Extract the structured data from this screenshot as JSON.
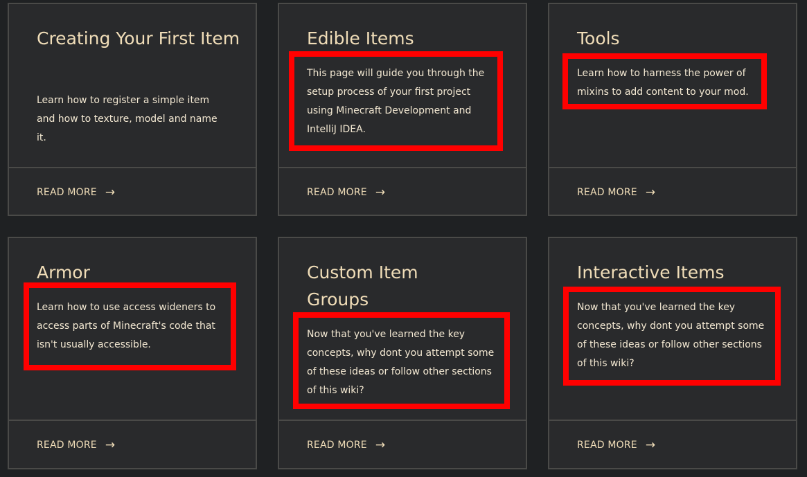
{
  "cards": [
    {
      "title": "Creating Your First Item",
      "description": "Learn how to register a simple item and how to texture, model and name it.",
      "read_more": "READ MORE",
      "highlighted": false
    },
    {
      "title": "Edible Items",
      "description": "This page will guide you through the setup process of your first project using Minecraft Development and IntelliJ IDEA.",
      "read_more": "READ MORE",
      "highlighted": true
    },
    {
      "title": "Tools",
      "description": "Learn how to harness the power of mixins to add content to your mod.",
      "read_more": "READ MORE",
      "highlighted": true
    },
    {
      "title": "Armor",
      "description": "Learn how to use access wideners to access parts of Minecraft's code that isn't usually accessible.",
      "read_more": "READ MORE",
      "highlighted": true
    },
    {
      "title": "Custom Item Groups",
      "description": "Now that you've learned the key concepts, why dont you attempt some of these ideas or follow other sections of this wiki?",
      "read_more": "READ MORE",
      "highlighted": true
    },
    {
      "title": "Interactive Items",
      "description": "Now that you've learned the key concepts, why dont you attempt some of these ideas or follow other sections of this wiki?",
      "read_more": "READ MORE",
      "highlighted": true
    }
  ],
  "icons": {
    "read_more": "arrow-right-icon"
  },
  "colors": {
    "background": "#1f2123",
    "card": "#292a2c",
    "border": "#4a4a48",
    "title": "#f0ddb8",
    "highlight": "#ff0000"
  }
}
